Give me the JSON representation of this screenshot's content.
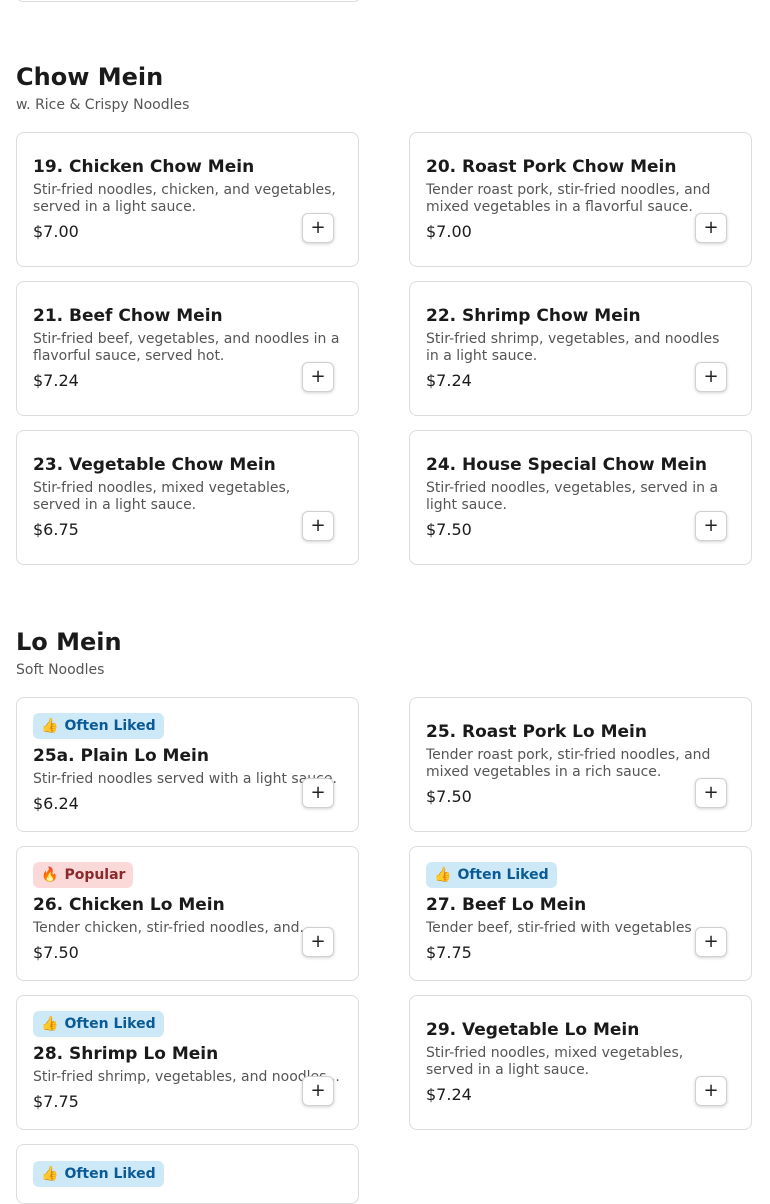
{
  "sections": [
    {
      "title": "Chow Mein",
      "subtitle": "w. Rice & Crispy Noodles",
      "items": [
        {
          "name": "19. Chicken Chow Mein",
          "desc": "Stir-fried noodles, chicken, and vegetables, served in a light sauce.",
          "price": "$7.00"
        },
        {
          "name": "20. Roast Pork Chow Mein",
          "desc": "Tender roast pork, stir-fried noodles, and mixed vegetables in a flavorful sauce.",
          "price": "$7.00"
        },
        {
          "name": "21. Beef Chow Mein",
          "desc": "Stir-fried beef, vegetables, and noodles in a flavorful sauce, served hot.",
          "price": "$7.24"
        },
        {
          "name": "22. Shrimp Chow Mein",
          "desc": "Stir-fried shrimp, vegetables, and noodles in a light sauce.",
          "price": "$7.24"
        },
        {
          "name": "23. Vegetable Chow Mein",
          "desc": "Stir-fried noodles, mixed vegetables, served in a light sauce.",
          "price": "$6.75"
        },
        {
          "name": "24. House Special Chow Mein",
          "desc": "Stir-fried noodles, vegetables, served in a light sauce.",
          "price": "$7.50"
        }
      ]
    },
    {
      "title": "Lo Mein",
      "subtitle": "Soft Noodles",
      "items": [
        {
          "badge": {
            "icon": "👍",
            "label": "Often Liked",
            "kind": "liked"
          },
          "name": "25a. Plain Lo Mein",
          "desc": "Stir-fried noodles served with a light sauce.",
          "price": "$6.24"
        },
        {
          "name": "25. Roast Pork Lo Mein",
          "desc": "Tender roast pork, stir-fried noodles, and mixed vegetables in a rich sauce.",
          "price": "$7.50"
        },
        {
          "badge": {
            "icon": "🔥",
            "label": "Popular",
            "kind": "popular"
          },
          "name": "26. Chicken Lo Mein",
          "desc": "Tender chicken, stir-fried noodles, and...",
          "price": "$7.50"
        },
        {
          "badge": {
            "icon": "👍",
            "label": "Often Liked",
            "kind": "liked"
          },
          "name": "27. Beef Lo Mein",
          "desc": "Tender beef, stir-fried with vegetables ...",
          "price": "$7.75"
        },
        {
          "badge": {
            "icon": "👍",
            "label": "Often Liked",
            "kind": "liked"
          },
          "name": "28. Shrimp Lo Mein",
          "desc": "Stir-fried shrimp, vegetables, and noodles...",
          "price": "$7.75"
        },
        {
          "name": "29. Vegetable Lo Mein",
          "desc": "Stir-fried noodles, mixed vegetables, served in a light sauce.",
          "price": "$7.24"
        },
        {
          "badge": {
            "icon": "👍",
            "label": "Often Liked",
            "kind": "liked"
          }
        }
      ]
    }
  ],
  "add_button_label": "+"
}
